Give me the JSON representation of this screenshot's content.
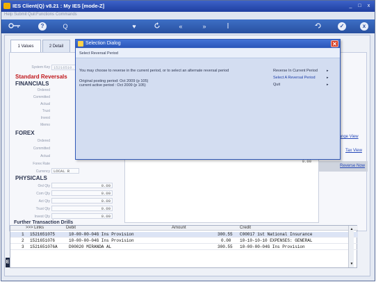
{
  "window": {
    "title": "IES Client(Q) v8.21 : My IES        [mode-Z]",
    "controls": [
      "_",
      "□",
      "x"
    ]
  },
  "menubar": {
    "items": [
      "Help",
      "Submit",
      "Quit",
      "Functions",
      "Commands"
    ]
  },
  "toolbar": {
    "icons": [
      "key-icon",
      "help-icon",
      "search-icon",
      "heart-icon",
      "refresh-icon",
      "back-icon",
      "forward-icon",
      "info-icon",
      "refresh-icon",
      "check-icon",
      "close-icon"
    ],
    "help_glyph": "?",
    "search_glyph": "Q",
    "heart_glyph": "♥",
    "back_glyph": "«",
    "forward_glyph": "»",
    "ok_glyph": "✓",
    "x_glyph": "x"
  },
  "tabs": [
    {
      "label": "1 Values"
    },
    {
      "label": "2 Detail"
    }
  ],
  "form": {
    "system_key_label": "System Key",
    "system_key_value": "15216510...",
    "reversal_title": "Standard Reversals",
    "financials_title": "FINANCIALS",
    "financials_rows": [
      "Ordered",
      "Committed",
      "Actual",
      "Trust",
      "Invest",
      "Memo"
    ],
    "forex_title": "FOREX",
    "forex_rows": [
      "Ordered",
      "Committed",
      "Actual",
      "Forex Rate",
      "Currency"
    ],
    "currency_value": "LOCAL R",
    "physicals_title": "PHYSICALS",
    "physicals_rows": [
      {
        "label": "Ord Qty",
        "value": "0.00"
      },
      {
        "label": "Com Qty",
        "value": "0.00"
      },
      {
        "label": "Act Qty",
        "value": "0.00"
      },
      {
        "label": "Trust Qty",
        "value": "0.00"
      },
      {
        "label": "Invest Qty",
        "value": "0.00"
      }
    ],
    "mid_value": "0.00"
  },
  "side_links": {
    "change_view": "Change View",
    "tax_view": "Tax View",
    "reverse_now": "Reverse Now"
  },
  "drills": {
    "title": "Further Transaction Drills",
    "headers": [
      ">>> Links",
      "Debit",
      "Amount",
      "Credit"
    ],
    "rows": [
      {
        "num": "1",
        "link": "1521651075",
        "debit": "10-00-00-04G Ins Provision",
        "amount": "300.55",
        "credit": "C00017 1st National Insurance"
      },
      {
        "num": "2",
        "link": "1521651076",
        "debit": "10-00-00-04G Ins Provision",
        "amount": "0.00",
        "credit": "10-10-10-10 EXPENSES: GENERAL"
      },
      {
        "num": "3",
        "link": "1521651076A",
        "debit": "D00020 MIRANDA AL",
        "amount": "300.55",
        "credit": "10-00-00-04G Ins Provision"
      }
    ],
    "side_button": "E"
  },
  "dialog": {
    "title": "Selection Dialog",
    "subtitle": "Select Reversal Period",
    "close": "✕",
    "message": "You may choose to reverse in the current period, or to select an alternate reversal period",
    "original_period": "Original posting period: Oct 2009 (p 105)",
    "current_period": "current active period :   Oct 2009 (p 105)",
    "options": [
      {
        "label": "Reverse In Current Period"
      },
      {
        "label": "Select A Reversal Period"
      },
      {
        "label": "Quit"
      }
    ],
    "arrow": "▸"
  },
  "colors": {
    "titlebar": "#2a4fb0",
    "toolbar": "#3262b8",
    "reversal_red": "#c0161a",
    "link_blue": "#2346b8",
    "dialog_bg": "#d3ddf1"
  }
}
